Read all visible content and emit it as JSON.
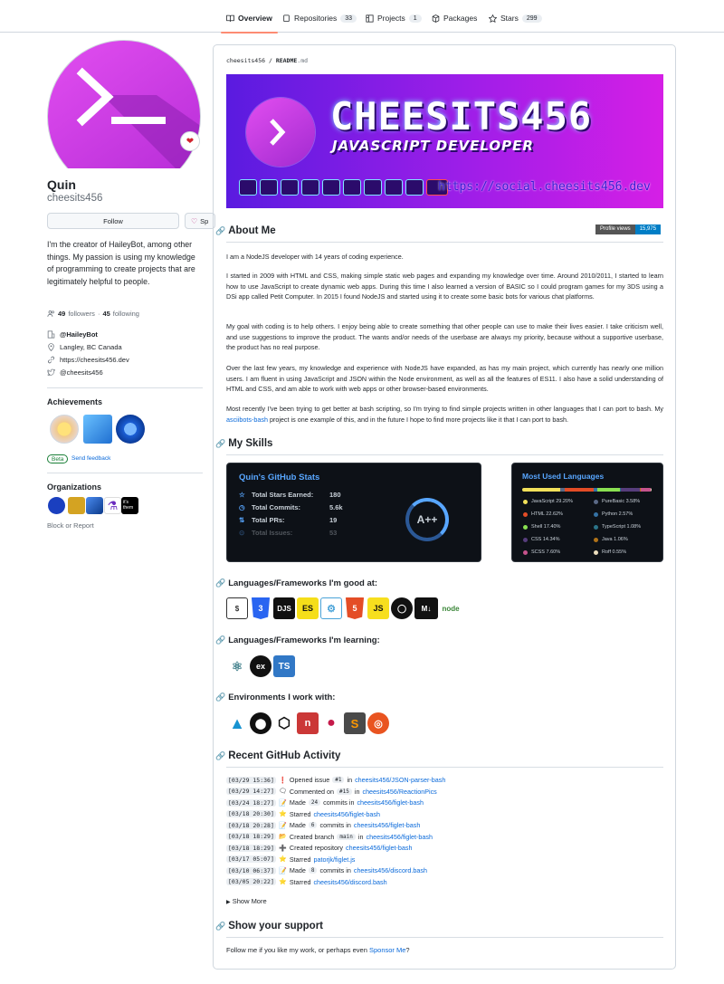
{
  "tabs": [
    {
      "label": "Overview",
      "count": ""
    },
    {
      "label": "Repositories",
      "count": "33"
    },
    {
      "label": "Projects",
      "count": "1"
    },
    {
      "label": "Packages",
      "count": ""
    },
    {
      "label": "Stars",
      "count": "299"
    }
  ],
  "profile": {
    "name": "Quin",
    "handle": "cheesits456",
    "follow_label": "Follow",
    "sponsor_label": "Sp",
    "bio": "I'm the creator of HaileyBot, among other things. My passion is using my knowledge of programming to create projects that are legitimately helpful to people.",
    "followers": "49",
    "followers_label": "followers",
    "sep": "·",
    "following": "45",
    "following_label": "following",
    "org": "@HaileyBot",
    "location": "Langley, BC Canada",
    "website": "https://cheesits456.dev",
    "twitter": "@cheesits456",
    "achievements_title": "Achievements",
    "beta": "Beta",
    "send_feedback": "Send feedback",
    "organizations_title": "Organizations",
    "org_its_them": "it's them",
    "block": "Block or Report"
  },
  "readme": {
    "breadcrumb_user": "cheesits456",
    "breadcrumb_sep": "/",
    "breadcrumb_file": "README",
    "breadcrumb_ext": ".md",
    "banner_title": "CHEESITS456",
    "banner_sub": "JAVASCRIPT DEVELOPER",
    "banner_url": "https://social.cheesits456.dev",
    "about_title": "About Me",
    "views_label": "Profile views",
    "views_count": "15,975",
    "p1": "I am a NodeJS developer with 14 years of coding experience.",
    "p2": "I started in 2009 with HTML and CSS, making simple static web pages and expanding my knowledge over time. Around 2010/2011, I started to learn how to use JavaScript to create dynamic web apps. During this time I also learned a version of BASIC so I could program games for my 3DS using a DSi app called Petit Computer. In 2015 I found NodeJS and started using it to create some basic bots for various chat platforms.",
    "p3": "My goal with coding is to help others. I enjoy being able to create something that other people can use to make their lives easier. I take criticism well, and use suggestions to improve the product. The wants and/or needs of the userbase are always my priority, because without a supportive userbase, the product has no real purpose.",
    "p4": "Over the last few years, my knowledge and experience with NodeJS have expanded, as has my main project, which currently has nearly one million users. I am fluent in using JavaScript and JSON within the Node environment, as well as all the features of ES11. I also have a solid understanding of HTML and CSS, and am able to work with web apps or other browser-based environments.",
    "p5a": "Most recently I've been trying to get better at bash scripting, so I'm trying to find simple projects written in other languages that I can port to bash. My ",
    "p5link": "asciibots-bash",
    "p5b": " project is one example of this, and in the future I hope to find more projects like it that I can port to bash.",
    "skills_title": "My Skills",
    "stats": {
      "title": "Quin's GitHub Stats",
      "rows": [
        {
          "label": "Total Stars Earned:",
          "value": "180"
        },
        {
          "label": "Total Commits:",
          "value": "5.6k"
        },
        {
          "label": "Total PRs:",
          "value": "19"
        },
        {
          "label": "Total Issues:",
          "value": "53"
        }
      ],
      "grade": "A++"
    },
    "langs": {
      "title": "Most Used Languages",
      "items": [
        {
          "label": "JavaScript 29.20%",
          "color": "#f1e05a"
        },
        {
          "label": "PureBasic 3.58%",
          "color": "#5a6986"
        },
        {
          "label": "HTML 22.62%",
          "color": "#e34c26"
        },
        {
          "label": "Python 2.57%",
          "color": "#3572A5"
        },
        {
          "label": "Shell 17.40%",
          "color": "#89e051"
        },
        {
          "label": "TypeScript 1.08%",
          "color": "#2b7489"
        },
        {
          "label": "CSS 14.34%",
          "color": "#563d7c"
        },
        {
          "label": "Java 1.06%",
          "color": "#b07219"
        },
        {
          "label": "SCSS 7.60%",
          "color": "#c6538c"
        },
        {
          "label": "Roff 0.55%",
          "color": "#ecdebe"
        }
      ]
    },
    "good_title": "Languages/Frameworks I'm good at:",
    "good": [
      "bash",
      "css3",
      "djs",
      "es",
      "electron",
      "html5",
      "js",
      "nodejs",
      "md",
      "node"
    ],
    "learning_title": "Languages/Frameworks I'm learning:",
    "learning": [
      "electron",
      "ex",
      "TS"
    ],
    "env_title": "Environments I work with:",
    "envs": [
      "arch",
      "github",
      "box",
      "npm",
      "raspberry-pi",
      "sublime",
      "ubuntu"
    ],
    "activity_title": "Recent GitHub Activity",
    "activity": [
      {
        "ts": "[03/29 15:36]",
        "icon": "❗",
        "pre": "Opened issue",
        "num": "#1",
        "mid": "in",
        "repo": "cheesits456/JSON-parser-bash"
      },
      {
        "ts": "[03/29 14:27]",
        "icon": "🗨",
        "pre": "Commented on",
        "num": "#15",
        "mid": "in",
        "repo": "cheesits456/ReactionPics"
      },
      {
        "ts": "[03/24 18:27]",
        "icon": "📝",
        "pre": "Made",
        "num": "24",
        "mid": "commits in",
        "repo": "cheesits456/figlet-bash"
      },
      {
        "ts": "[03/18 20:30]",
        "icon": "⭐",
        "pre": "Starred",
        "num": "",
        "mid": "",
        "repo": "cheesits456/figlet-bash"
      },
      {
        "ts": "[03/18 20:28]",
        "icon": "📝",
        "pre": "Made",
        "num": "6",
        "mid": "commits in",
        "repo": "cheesits456/figlet-bash"
      },
      {
        "ts": "[03/18 18:29]",
        "icon": "📂",
        "pre": "Created branch",
        "num": "main",
        "mid": "in",
        "repo": "cheesits456/figlet-bash"
      },
      {
        "ts": "[03/18 18:29]",
        "icon": "➕",
        "pre": "Created repository",
        "num": "",
        "mid": "",
        "repo": "cheesits456/figlet-bash"
      },
      {
        "ts": "[03/17 05:07]",
        "icon": "⭐",
        "pre": "Starred",
        "num": "",
        "mid": "",
        "repo": "patorjk/figlet.js"
      },
      {
        "ts": "[03/10 06:37]",
        "icon": "📝",
        "pre": "Made",
        "num": "8",
        "mid": "commits in",
        "repo": "cheesits456/discord.bash"
      },
      {
        "ts": "[03/05 20:22]",
        "icon": "⭐",
        "pre": "Starred",
        "num": "",
        "mid": "",
        "repo": "cheesits456/discord.bash"
      }
    ],
    "show_more": "Show More",
    "support_title": "Show your support",
    "support_pre": "Follow me if you like my work, or perhaps even ",
    "support_link": "Sponsor Me",
    "support_post": "?"
  }
}
